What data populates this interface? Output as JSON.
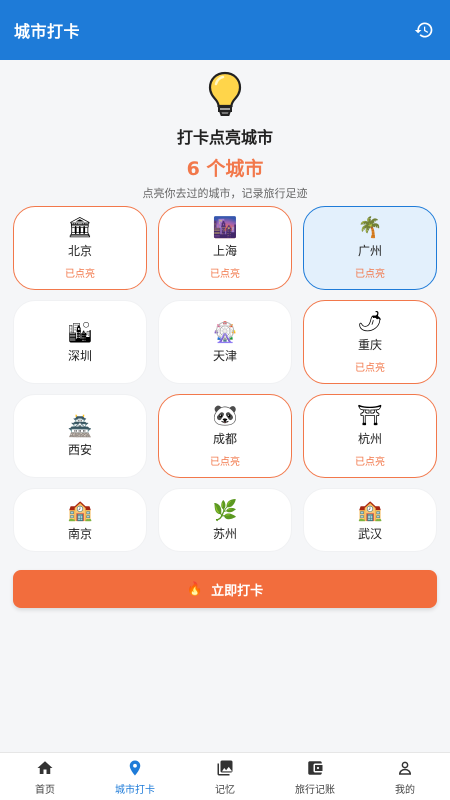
{
  "header": {
    "title": "城市打卡",
    "history_icon": "history-icon"
  },
  "hero": {
    "icon": "lightbulb-icon",
    "title": "打卡点亮城市",
    "count_text": "6 个城市",
    "subtitle": "点亮你去过的城市，记录旅行足迹"
  },
  "cities": [
    {
      "name": "北京",
      "icon": "🏛",
      "status": "已点亮"
    },
    {
      "name": "上海",
      "icon": "🌆",
      "status": "已点亮"
    },
    {
      "name": "广州",
      "icon": "🌴",
      "status": "已点亮"
    },
    {
      "name": "深圳",
      "icon": "🏙",
      "status": ""
    },
    {
      "name": "天津",
      "icon": "🎡",
      "status": ""
    },
    {
      "name": "重庆",
      "icon": "🌶",
      "status": "已点亮"
    },
    {
      "name": "西安",
      "icon": "🏯",
      "status": ""
    },
    {
      "name": "成都",
      "icon": "🐼",
      "status": "已点亮"
    },
    {
      "name": "杭州",
      "icon": "⛩",
      "status": "已点亮"
    },
    {
      "name": "南京",
      "icon": "🏫",
      "status": ""
    },
    {
      "name": "苏州",
      "icon": "🌿",
      "status": ""
    },
    {
      "name": "武汉",
      "icon": "🏫",
      "status": ""
    }
  ],
  "checkin": {
    "label": "立即打卡",
    "icon": "🔥"
  },
  "tabs": [
    {
      "label": "首页",
      "icon": "home-icon"
    },
    {
      "label": "城市打卡",
      "icon": "location-icon"
    },
    {
      "label": "记忆",
      "icon": "photo-icon"
    },
    {
      "label": "旅行记账",
      "icon": "wallet-icon"
    },
    {
      "label": "我的",
      "icon": "person-icon"
    }
  ],
  "colors": {
    "primary": "#1e7bd8",
    "accent": "#f2784b",
    "selected_bg": "#e3f0fc"
  }
}
